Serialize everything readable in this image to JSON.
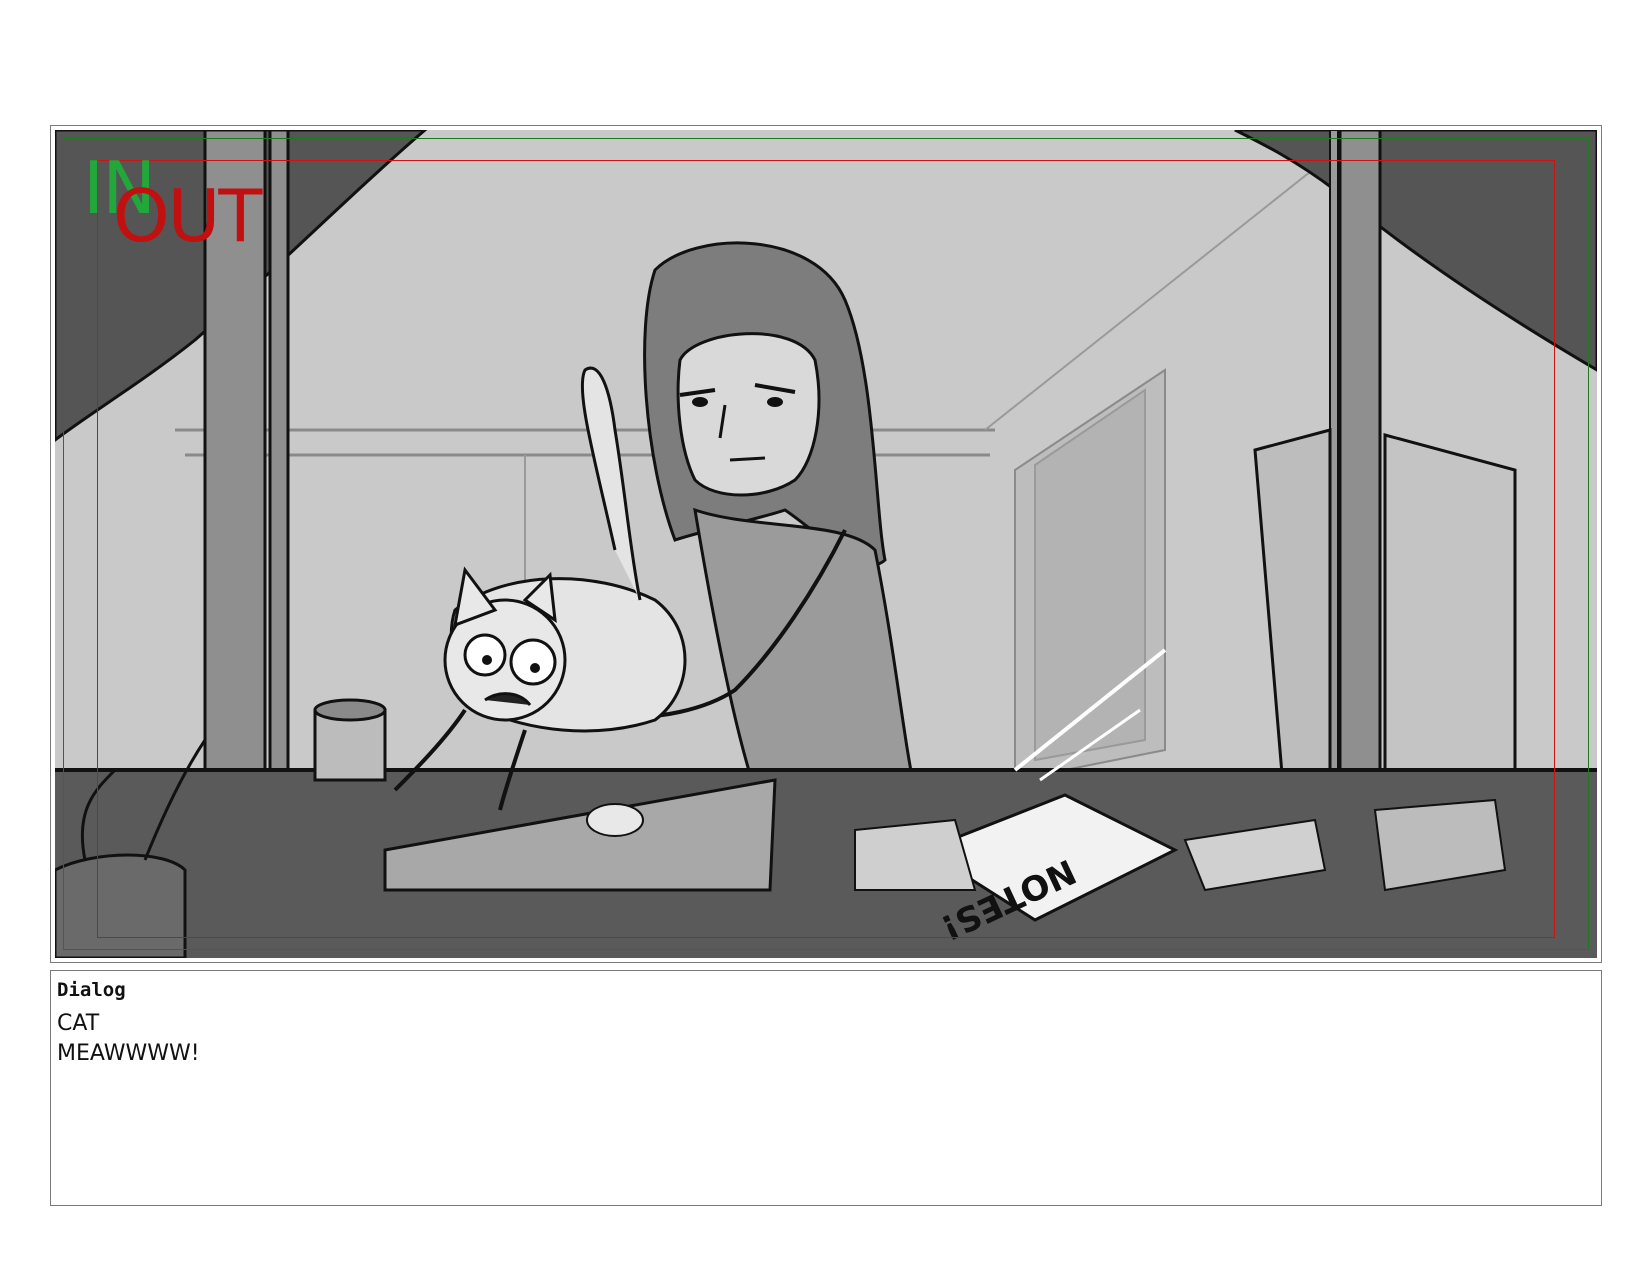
{
  "panel": {
    "in_label": "IN",
    "out_label": "OUT",
    "colors": {
      "in": "#22a83a",
      "out": "#c01010",
      "safe_green": "#1e7a1e",
      "safe_red": "#c81414"
    },
    "sketch_notes_text": "NOTES!"
  },
  "dialog": {
    "heading": "Dialog",
    "lines": [
      "CAT",
      "MEAWWWW!"
    ]
  }
}
